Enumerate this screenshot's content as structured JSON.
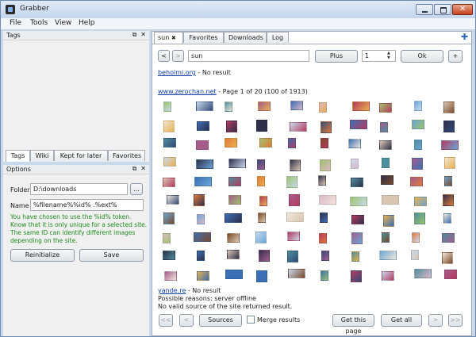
{
  "window": {
    "title": "Grabber"
  },
  "menu": [
    "File",
    "Tools",
    "View",
    "Help"
  ],
  "tags_dock": {
    "title": "Tags",
    "tabs": [
      "Tags",
      "Wiki",
      "Kept for later",
      "Favorites"
    ],
    "active_tab": "Tags"
  },
  "options_dock": {
    "title": "Options",
    "folder_label": "Folder",
    "folder_value": "D:\\downloads",
    "browse_label": "...",
    "name_label": "Name",
    "name_value": "%filename%%id% .%ext%",
    "warning_lines": [
      "You have chosen to use the %id% token.",
      "Know that it is only unique for a selected site.",
      "The same ID can identify different images",
      "depending on the site."
    ],
    "reinitialize_label": "Reinitialize",
    "save_label": "Save"
  },
  "main": {
    "tabs": [
      "sun",
      "Favorites",
      "Downloads",
      "Log"
    ],
    "active_tab": "sun",
    "search": {
      "value": "sun",
      "plus_label": "Plus",
      "page_value": "1",
      "ok_label": "Ok",
      "add_label": "+"
    },
    "nav": {
      "prev": "<",
      "next": ">"
    },
    "site1": {
      "name": "behoimi.org",
      "status": " - No result"
    },
    "site2": {
      "name": "www.zerochan.net",
      "status": " - Page 1 of 20 (100 of 1913)"
    },
    "site3": {
      "name": "yande.re",
      "status": " - No result",
      "reason": "Possible reasons: server offline",
      "source": "No valid source of the site returned result."
    },
    "bottom": {
      "first": "<<",
      "prev": "<",
      "sources": "Sources",
      "merge": "Merge results",
      "get_page": "Get this page",
      "get_all": "Get all",
      "next": ">",
      "last": ">>"
    }
  },
  "colors": {
    "accent": "#0a3ea8",
    "warning_text": "#1e8a1e",
    "window_frame": "#c9d9ec"
  }
}
